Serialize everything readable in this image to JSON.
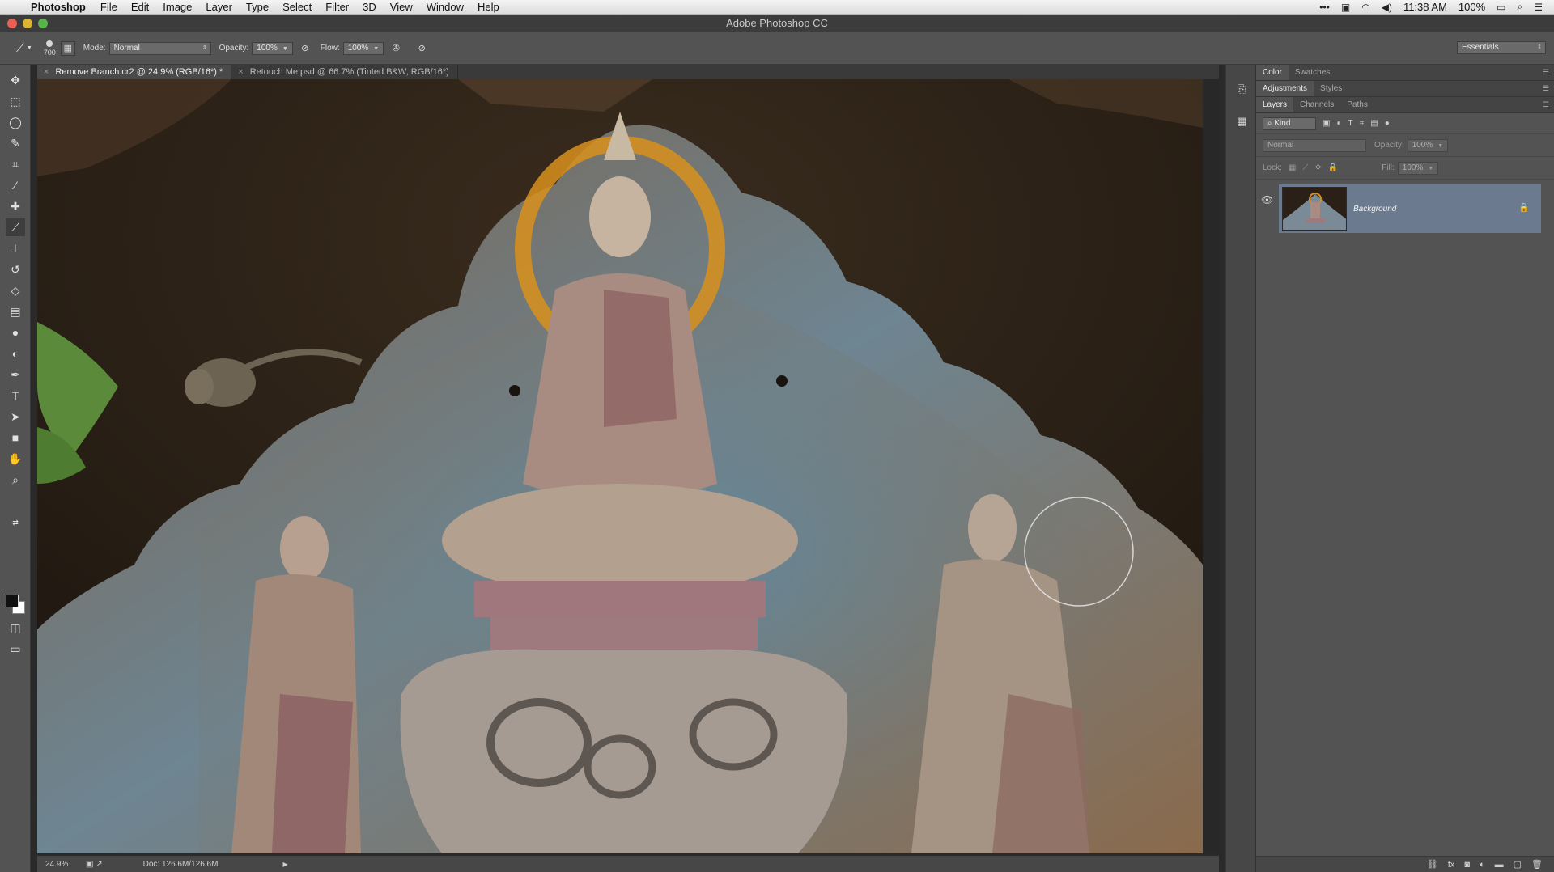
{
  "menubar": {
    "app_name": "Photoshop",
    "items": [
      "File",
      "Edit",
      "Image",
      "Layer",
      "Type",
      "Select",
      "Filter",
      "3D",
      "View",
      "Window",
      "Help"
    ],
    "time": "11:38 AM",
    "battery": "100%"
  },
  "window": {
    "title": "Adobe Photoshop CC"
  },
  "options": {
    "brush_size": "700",
    "mode_label": "Mode:",
    "mode_value": "Normal",
    "opacity_label": "Opacity:",
    "opacity_value": "100%",
    "flow_label": "Flow:",
    "flow_value": "100%",
    "workspace": "Essentials"
  },
  "tabs": [
    {
      "label": "Remove Branch.cr2 @ 24.9% (RGB/16*) *",
      "active": true
    },
    {
      "label": "Retouch Me.psd @ 66.7% (Tinted B&W, RGB/16*)",
      "active": false
    }
  ],
  "status": {
    "zoom": "24.9%",
    "doc": "Doc: 126.6M/126.6M"
  },
  "panels": {
    "group1": [
      "Color",
      "Swatches"
    ],
    "group2": [
      "Adjustments",
      "Styles"
    ],
    "group3": [
      "Layers",
      "Channels",
      "Paths"
    ],
    "kind_label": "Kind",
    "blend_mode": "Normal",
    "opacity_label": "Opacity:",
    "opacity_value": "100%",
    "lock_label": "Lock:",
    "fill_label": "Fill:",
    "fill_value": "100%",
    "layer_name": "Background"
  },
  "icons": {
    "tools": [
      "move-icon",
      "marquee-icon",
      "lasso-icon",
      "quick-select-icon",
      "crop-icon",
      "eyedropper-icon",
      "healing-brush-icon",
      "brush-icon",
      "clone-stamp-icon",
      "history-brush-icon",
      "eraser-icon",
      "gradient-icon",
      "blur-icon",
      "dodge-icon",
      "pen-icon",
      "type-icon",
      "path-select-icon",
      "rectangle-icon",
      "hand-icon",
      "zoom-icon"
    ]
  },
  "colors": {
    "accent_layer": "#6b7a8f",
    "app_bg": "#535353"
  }
}
